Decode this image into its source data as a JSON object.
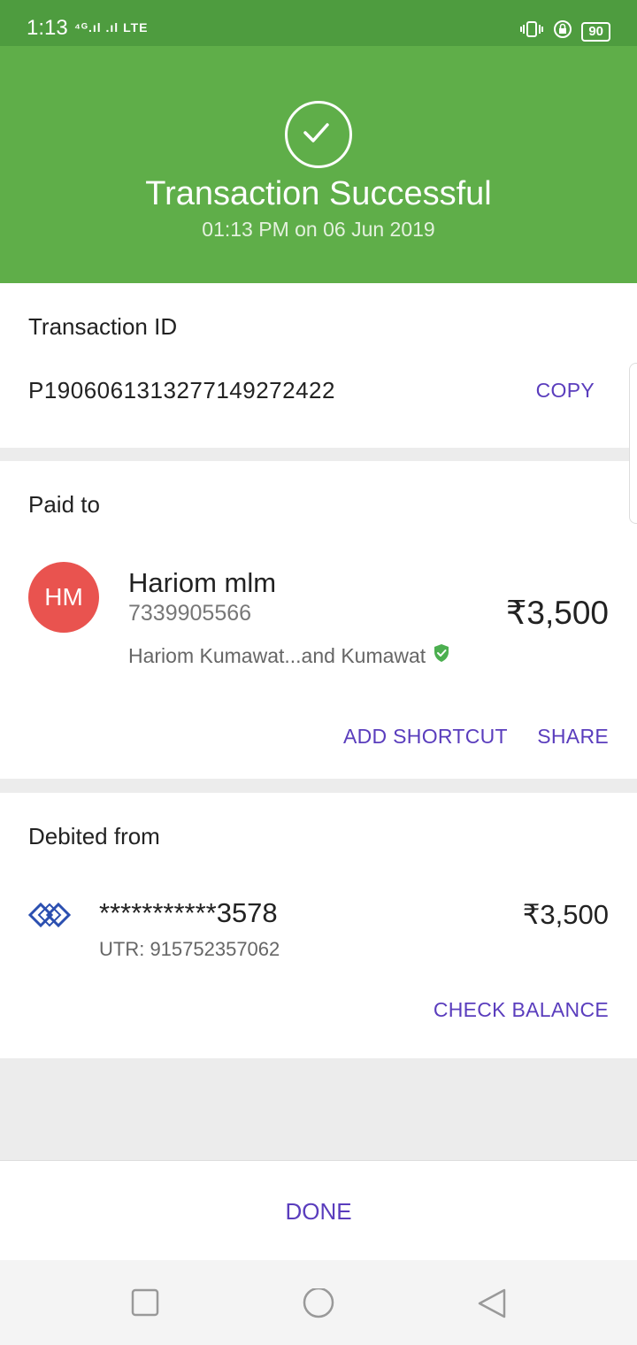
{
  "status": {
    "time": "1:13",
    "network": "⁴ᴳ.ıl .ıl LTE",
    "battery": "90"
  },
  "hero": {
    "title": "Transaction Successful",
    "subtitle": "01:13 PM on 06 Jun 2019"
  },
  "transaction": {
    "label": "Transaction ID",
    "id": "P1906061313277149272422",
    "copy_label": "COPY"
  },
  "paid_to": {
    "label": "Paid to",
    "avatar_initials": "HM",
    "name": "Hariom mlm",
    "phone": "7339905566",
    "bank_name": "Hariom Kumawat...and Kumawat",
    "amount": "₹3,500",
    "add_shortcut_label": "ADD SHORTCUT",
    "share_label": "SHARE"
  },
  "debited_from": {
    "label": "Debited from",
    "account": "***********3578",
    "utr": "UTR: 915752357062",
    "amount": "₹3,500",
    "check_balance_label": "CHECK BALANCE"
  },
  "footer": {
    "done_label": "DONE"
  },
  "colors": {
    "success_green": "#5fae49",
    "accent_purple": "#5a3dbd",
    "avatar_red": "#e9534f",
    "verified_green": "#4caf50"
  }
}
